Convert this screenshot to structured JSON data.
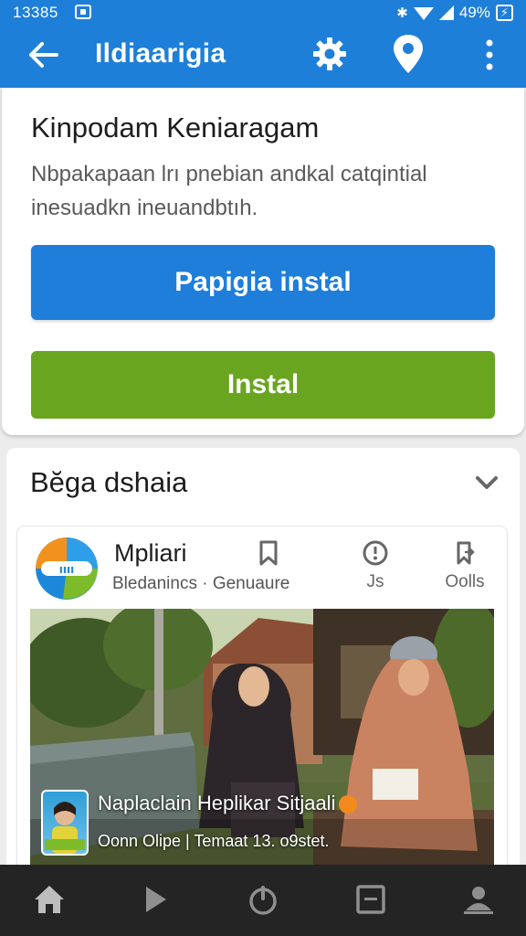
{
  "status_bar": {
    "time": "13385",
    "battery": "49%",
    "bluetooth": "✱",
    "icons": [
      "notification-icon",
      "bluetooth-icon",
      "wifi-icon",
      "signal-icon",
      "battery-icon"
    ]
  },
  "app_bar": {
    "title": "Ildiaarigia",
    "icons": [
      "back-arrow-icon",
      "gear-icon",
      "location-pin-icon",
      "more-vert-icon"
    ]
  },
  "install_card": {
    "title": "Kinpodam Keniaragam",
    "description": "Nbpakapaan lrı pnebian andkal catqintial inesuadkn ineuandbtıh.",
    "primary_button": "Papigia instal",
    "secondary_button": "Instal"
  },
  "section": {
    "title": "Bĕga dshaia",
    "item": {
      "name": "Mpliari",
      "meta": "Bledanincs · Genuaure",
      "actions": [
        {
          "icon": "bookmark-icon",
          "label": ""
        },
        {
          "icon": "alert-circle-icon",
          "label": "Js"
        },
        {
          "icon": "share-icon",
          "label": "Oolls"
        }
      ],
      "caption_title": "Naplaclain Heplikar Sitjaali",
      "caption_sub": "Oonn Olipe | Temaat 13. o9stet."
    }
  },
  "bottom_nav": [
    "home-icon",
    "play-icon",
    "power-icon",
    "tablet-icon",
    "profile-icon"
  ],
  "colors": {
    "primary": "#1e7fd8",
    "accent_green": "#6aa520",
    "nav_bg": "#242424"
  }
}
